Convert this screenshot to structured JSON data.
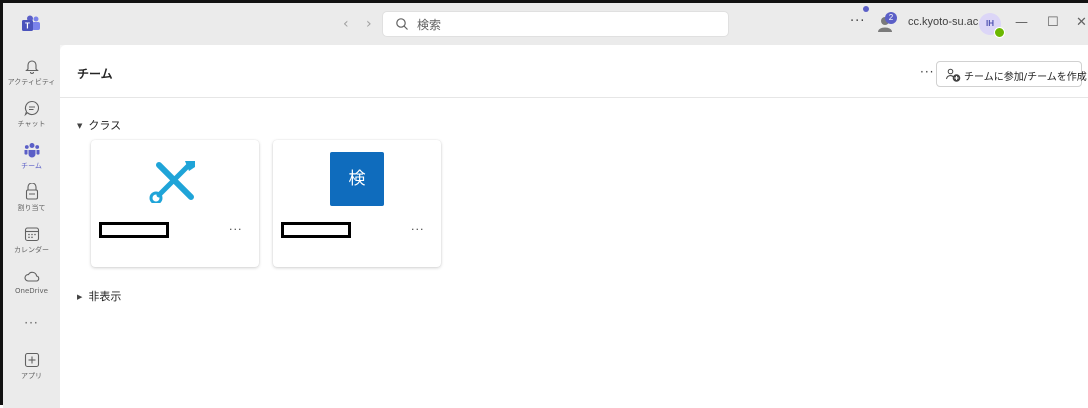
{
  "app": {
    "search_placeholder": "検索",
    "notification_count": "2",
    "org_name": "cc.kyoto-su.ac.jp",
    "user_initials": "IH",
    "window_controls": {
      "minimize": "—",
      "maximize": "☐",
      "close": "✕"
    },
    "nav": {
      "back": "‹",
      "forward": "›"
    },
    "more": "···"
  },
  "rail": {
    "items": [
      {
        "label": "アクティビティ",
        "icon": "bell-icon"
      },
      {
        "label": "チャット",
        "icon": "chat-icon"
      },
      {
        "label": "チーム",
        "icon": "teams-icon",
        "active": true
      },
      {
        "label": "割り当て",
        "icon": "assignments-icon"
      },
      {
        "label": "カレンダー",
        "icon": "calendar-icon"
      },
      {
        "label": "OneDrive",
        "icon": "cloud-icon"
      },
      {
        "label": "アプリ",
        "icon": "apps-icon"
      }
    ],
    "more": "···"
  },
  "page": {
    "title": "チーム",
    "more": "···",
    "join_button": "チームに参加/チームを作成"
  },
  "sections": {
    "classes": "クラス",
    "hidden": "非表示"
  },
  "cards": [
    {
      "icon": "tools-icon",
      "more": "···"
    },
    {
      "logo_text": "検",
      "more": "···"
    }
  ],
  "colors": {
    "accent": "#5b5fc7",
    "tile_blue": "#0f6cbd",
    "tools_cyan": "#1fa4d8",
    "presence_green": "#6bb700"
  }
}
